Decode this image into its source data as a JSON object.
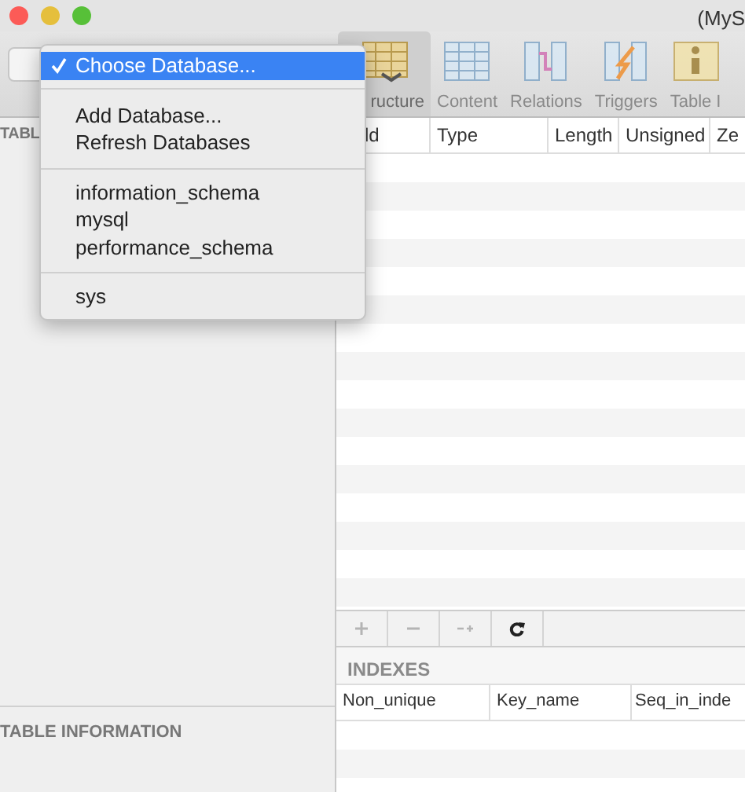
{
  "window": {
    "title": "(MyS"
  },
  "toolbar": {
    "tabs": [
      {
        "kind": "structure",
        "label": "ructure",
        "selected": true
      },
      {
        "kind": "content",
        "label": "Content",
        "selected": false
      },
      {
        "kind": "relations",
        "label": "Relations",
        "selected": false
      },
      {
        "kind": "triggers",
        "label": "Triggers",
        "selected": false
      },
      {
        "kind": "info",
        "label": "Table I",
        "selected": false
      }
    ]
  },
  "sidebar": {
    "header": "TABL",
    "footer": "TABLE INFORMATION"
  },
  "fields_table": {
    "columns": [
      "ld",
      "Type",
      "Length",
      "Unsigned",
      "Ze"
    ]
  },
  "table_actions": [
    {
      "kind": "add",
      "disabled": true
    },
    {
      "kind": "remove",
      "disabled": true
    },
    {
      "kind": "duplicate",
      "disabled": true
    },
    {
      "kind": "refresh",
      "disabled": false
    }
  ],
  "indexes": {
    "title": "INDEXES",
    "columns": [
      "Non_unique",
      "Key_name",
      "Seq_in_inde"
    ]
  },
  "menu": {
    "items": [
      {
        "kind": "item",
        "label": "Choose Database...",
        "selected": true,
        "checked": true
      },
      {
        "kind": "separator"
      },
      {
        "kind": "item",
        "label": "Add Database...",
        "selected": false,
        "checked": false
      },
      {
        "kind": "item",
        "label": "Refresh Databases",
        "selected": false,
        "checked": false
      },
      {
        "kind": "separator"
      },
      {
        "kind": "item",
        "label": "information_schema",
        "selected": false,
        "checked": false
      },
      {
        "kind": "item",
        "label": "mysql",
        "selected": false,
        "checked": false
      },
      {
        "kind": "item",
        "label": "performance_schema",
        "selected": false,
        "checked": false
      },
      {
        "kind": "separator"
      },
      {
        "kind": "item",
        "label": "sys",
        "selected": false,
        "checked": false
      }
    ]
  }
}
